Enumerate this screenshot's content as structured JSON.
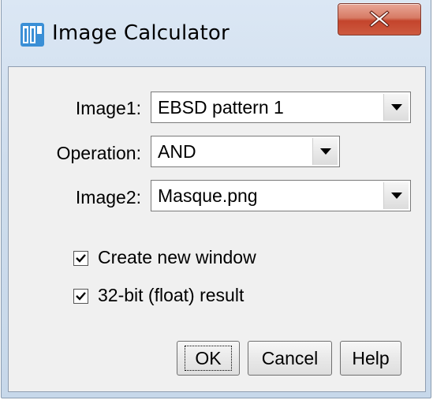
{
  "window": {
    "title": "Image Calculator",
    "icon": "imagej-icon",
    "close_icon": "close-icon"
  },
  "form": {
    "image1": {
      "label": "Image1:",
      "value": "EBSD pattern 1"
    },
    "operation": {
      "label": "Operation:",
      "value": "AND"
    },
    "image2": {
      "label": "Image2:",
      "value": "Masque.png"
    }
  },
  "options": {
    "create_new_window": {
      "label": "Create new window",
      "checked": true
    },
    "float_result": {
      "label": "32-bit (float) result",
      "checked": true
    }
  },
  "buttons": {
    "ok": "OK",
    "cancel": "Cancel",
    "help": "Help"
  },
  "colors": {
    "frame": "#cfdded",
    "client": "#f0f0f0",
    "close_button": "#c4442c",
    "icon_blue": "#3a8fd6"
  }
}
